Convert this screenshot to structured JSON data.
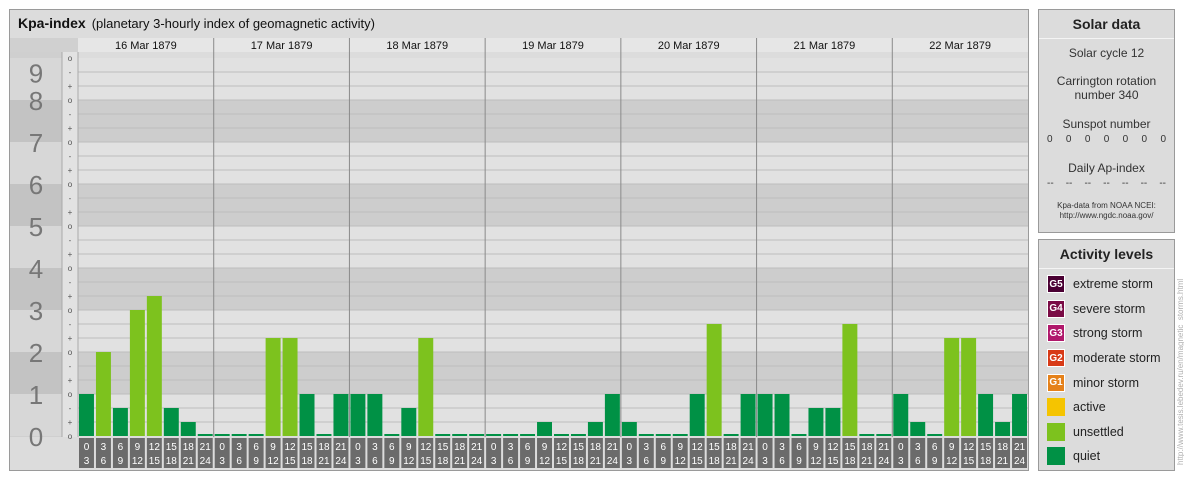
{
  "header": {
    "title": "Kpa-index",
    "subtitle": "(planetary 3-hourly index of geomagnetic activity)"
  },
  "chart_data": {
    "type": "bar",
    "ylim": [
      0,
      9
    ],
    "y_ticks": [
      "0",
      "1",
      "2",
      "3",
      "4",
      "5",
      "6",
      "7",
      "8",
      "9"
    ],
    "sub_ticks": [
      "o",
      "+",
      "-"
    ],
    "days": [
      "16 Mar 1879",
      "17 Mar 1879",
      "18 Mar 1879",
      "19 Mar 1879",
      "20 Mar 1879",
      "21 Mar 1879",
      "22 Mar 1879"
    ],
    "interval_start_labels": [
      "0",
      "3",
      "6",
      "9",
      "12",
      "15",
      "18",
      "21"
    ],
    "interval_end_labels": [
      "3",
      "6",
      "9",
      "12",
      "15",
      "18",
      "21",
      "24"
    ],
    "values": [
      [
        1.0,
        2.0,
        0.667,
        3.0,
        3.333,
        0.667,
        0.333,
        0
      ],
      [
        0,
        0,
        0,
        2.333,
        2.333,
        1.0,
        0,
        1.0
      ],
      [
        1.0,
        1.0,
        0,
        0.667,
        2.333,
        0,
        0,
        0
      ],
      [
        0,
        0,
        0,
        0.333,
        0,
        0,
        0.333,
        1.0
      ],
      [
        0.333,
        0,
        0,
        0,
        1.0,
        2.667,
        0,
        1.0
      ],
      [
        1.0,
        1.0,
        0,
        0.667,
        0.667,
        2.667,
        0,
        0
      ],
      [
        1.0,
        0.333,
        0,
        2.333,
        2.333,
        1.0,
        0.333,
        1.0
      ]
    ]
  },
  "solar_panel": {
    "title": "Solar data",
    "solar_cycle": "Solar cycle 12",
    "carrington": "Carrington rotation number 340",
    "sunspot_label": "Sunspot number",
    "sunspot_values": [
      "0",
      "0",
      "0",
      "0",
      "0",
      "0",
      "0"
    ],
    "ap_label": "Daily Ap-index",
    "ap_values": [
      "--",
      "--",
      "--",
      "--",
      "--",
      "--",
      "--"
    ],
    "source_line1": "Kpa-data from NOAA NCEI:",
    "source_line2": "http://www.ngdc.noaa.gov/"
  },
  "activity_panel": {
    "title": "Activity levels",
    "levels": [
      {
        "code": "G5",
        "label": "extreme storm",
        "color": "#4a0033"
      },
      {
        "code": "G4",
        "label": "severe storm",
        "color": "#7a0b45"
      },
      {
        "code": "G3",
        "label": "strong storm",
        "color": "#b0186b"
      },
      {
        "code": "G2",
        "label": "moderate storm",
        "color": "#d83a17"
      },
      {
        "code": "G1",
        "label": "minor storm",
        "color": "#e5811a"
      },
      {
        "code": "",
        "label": "active",
        "color": "#f5c400"
      },
      {
        "code": "",
        "label": "unsettled",
        "color": "#7dc21e"
      },
      {
        "code": "",
        "label": "quiet",
        "color": "#009145"
      }
    ]
  },
  "watermark": "http://www.tesis.lebedev.ru/en/magnetic_storms.html"
}
